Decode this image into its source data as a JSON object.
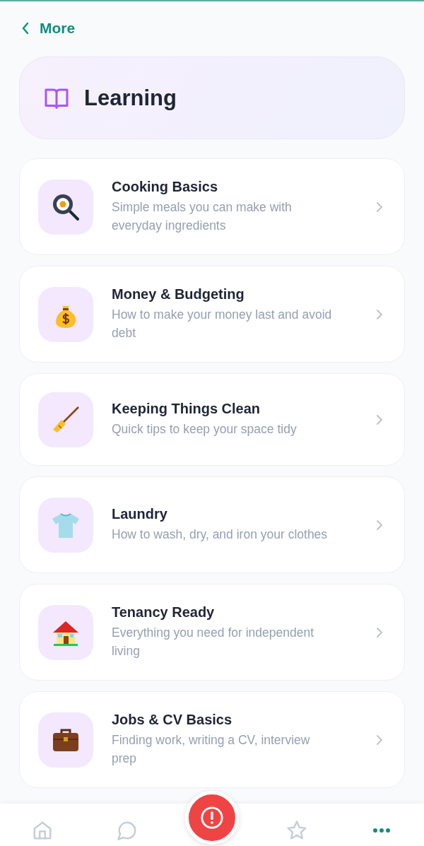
{
  "back": {
    "label": "More"
  },
  "header": {
    "title": "Learning"
  },
  "topics": [
    {
      "kind": "pan",
      "title": "Cooking Basics",
      "description": "Simple meals you can make with everyday ingredients"
    },
    {
      "kind": "moneybag",
      "title": "Money & Budgeting",
      "description": "How to make your money last and avoid debt"
    },
    {
      "kind": "broom",
      "title": "Keeping Things Clean",
      "description": "Quick tips to keep your space tidy"
    },
    {
      "kind": "tshirt",
      "title": "Laundry",
      "description": "How to wash, dry, and iron your clothes"
    },
    {
      "kind": "house",
      "title": "Tenancy Ready",
      "description": "Everything you need for independent living"
    },
    {
      "kind": "briefcase",
      "title": "Jobs & CV Basics",
      "description": "Finding work, writing a CV, interview prep"
    }
  ],
  "nav": [
    {
      "kind": "home",
      "selected": false
    },
    {
      "kind": "chat",
      "selected": false
    },
    {
      "kind": "alert",
      "selected": false
    },
    {
      "kind": "star",
      "selected": false
    },
    {
      "kind": "more",
      "selected": true
    }
  ]
}
